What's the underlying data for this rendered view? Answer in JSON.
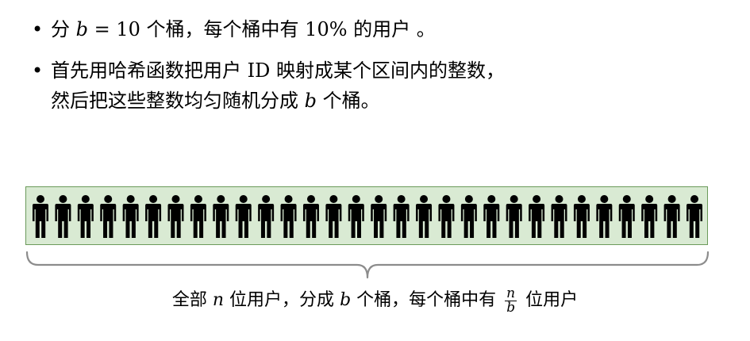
{
  "bullet_symbol": "•",
  "bullets": [
    {
      "lines": [
        [
          {
            "text": "分 ",
            "math": false
          },
          {
            "text": "b",
            "math": true
          },
          {
            "text": " = 10 个桶，每个桶中有 10% 的用户 。",
            "math": false
          }
        ]
      ]
    },
    {
      "lines": [
        [
          {
            "text": "首先用哈希函数把用户 ID 映射成某个区间内的整数，",
            "math": false
          }
        ],
        [
          {
            "text": "然后把这些整数均匀随机分成 ",
            "math": false
          },
          {
            "text": "b",
            "math": true
          },
          {
            "text": " 个桶。",
            "math": false
          }
        ]
      ]
    }
  ],
  "people": {
    "count": 30,
    "icon": "person-icon",
    "box_color": "#d9ead3",
    "border_color": "#6b9a5a",
    "icon_color": "#000000"
  },
  "caption": {
    "part1": "全部 ",
    "n": "n",
    "part2": " 位用户，分成 ",
    "b": "b",
    "part3": " 个桶，每个桶中有 ",
    "frac_num": "n",
    "frac_den": "b",
    "part4": " 位用户"
  }
}
